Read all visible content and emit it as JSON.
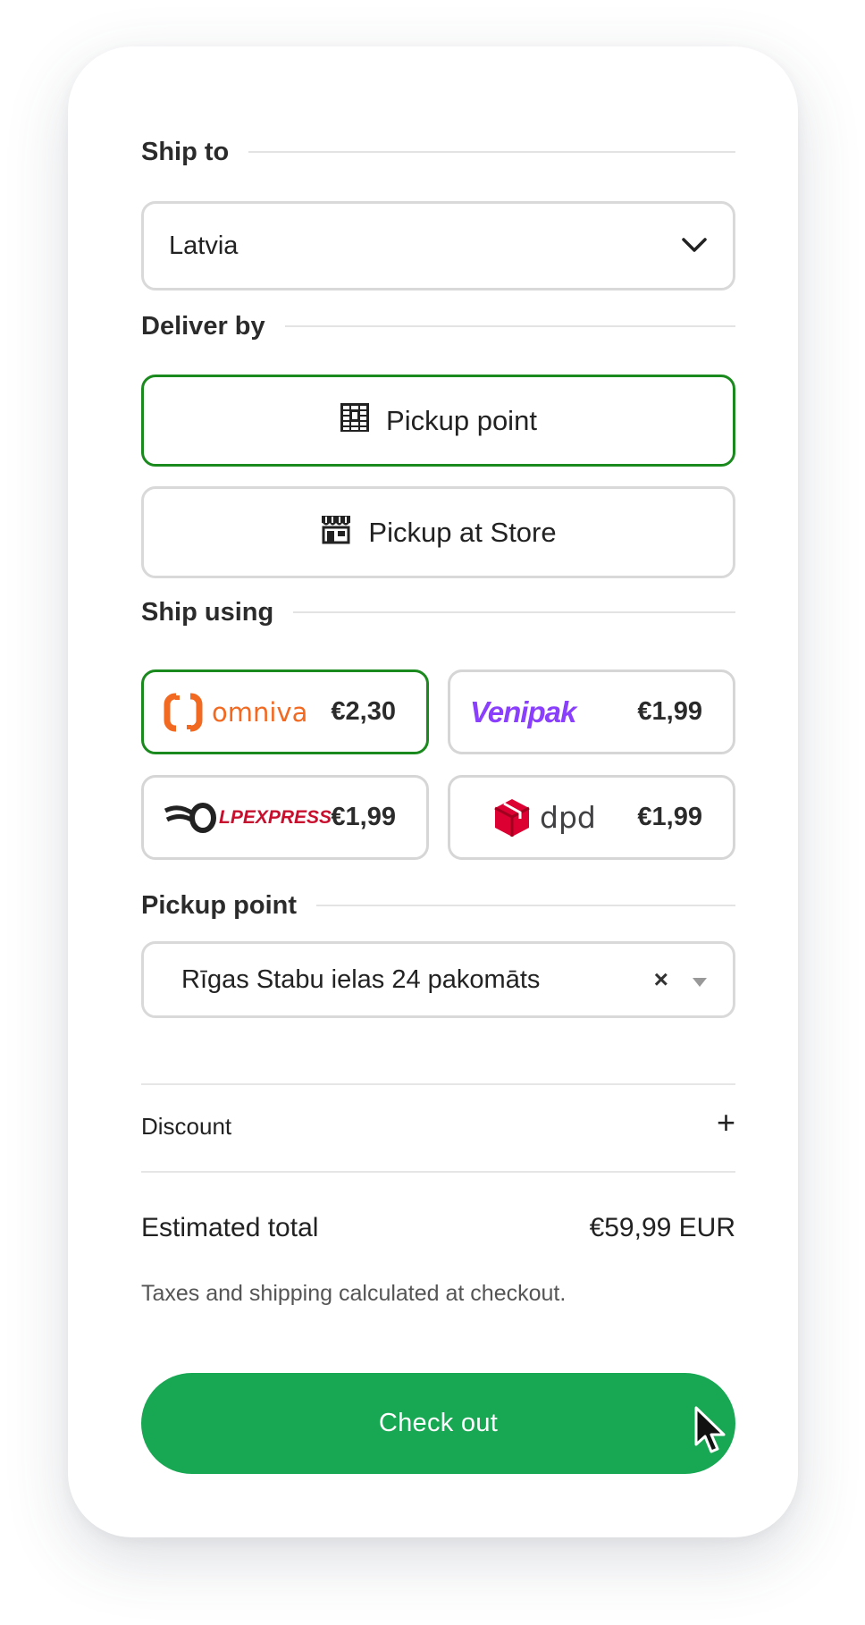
{
  "ship_to": {
    "title": "Ship to",
    "country": "Latvia"
  },
  "deliver_by": {
    "title": "Deliver by",
    "options": [
      {
        "label": "Pickup point",
        "icon": "parcel-locker-icon",
        "selected": true
      },
      {
        "label": "Pickup at Store",
        "icon": "store-icon",
        "selected": false
      }
    ]
  },
  "ship_using": {
    "title": "Ship using",
    "carriers": [
      {
        "name": "omniva",
        "price": "€2,30",
        "selected": true,
        "color": "#f26a21"
      },
      {
        "name": "Venipak",
        "price": "€1,99",
        "selected": false,
        "color": "#8a3ffc"
      },
      {
        "name": "LPEXPRESS",
        "price": "€1,99",
        "selected": false,
        "color": "#c8102e"
      },
      {
        "name": "dpd",
        "price": "€1,99",
        "selected": false,
        "color": "#dc0032"
      }
    ]
  },
  "pickup_point": {
    "title": "Pickup point",
    "value": "Rīgas Stabu ielas 24 pakomāts",
    "clear": "×"
  },
  "discount": {
    "label": "Discount",
    "toggle": "+"
  },
  "totals": {
    "label": "Estimated total",
    "amount": "€59,99 EUR",
    "note": "Taxes and shipping calculated at checkout."
  },
  "checkout": {
    "label": "Check out",
    "color": "#18a853"
  }
}
